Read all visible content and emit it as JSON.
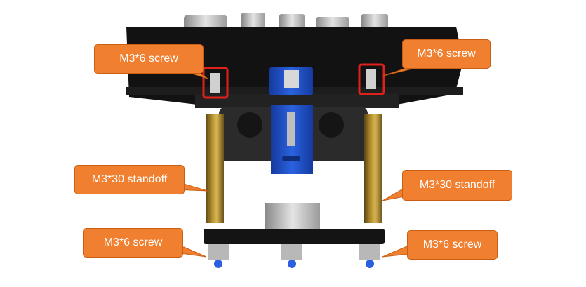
{
  "callouts": {
    "top_left": "M3*6 screw",
    "top_right": "M3*6 screw",
    "mid_left": "M3*30 standoff",
    "mid_right": "M3*30 standoff",
    "bottom_left": "M3*6 screw",
    "bottom_right": "M3*6 screw"
  },
  "colors": {
    "callout_fill": "#f07f2f",
    "highlight_box": "#e0201a",
    "board": "#0d0d0d",
    "bracket_blue": "#1e4fc8",
    "standoff_brass": "#9a7a2a"
  }
}
